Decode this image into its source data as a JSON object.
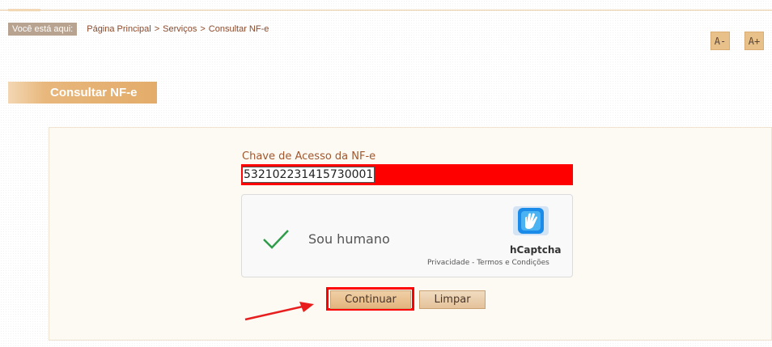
{
  "breadcrumb": {
    "label": "Você está aqui:",
    "items": [
      "Página Principal",
      "Serviços",
      "Consultar NF-e"
    ],
    "separator": ">"
  },
  "font_controls": {
    "decrease": "A-",
    "increase": "A+"
  },
  "section": {
    "title": "Consultar NF-e"
  },
  "form": {
    "field_label": "Chave de Acesso da NF-e",
    "field_value": "532102231415730001"
  },
  "captcha": {
    "label": "Sou humano",
    "brand": "hCaptcha",
    "links": "Privacidade - Termos e Condições"
  },
  "buttons": {
    "continue": "Continuar",
    "clear": "Limpar"
  },
  "colors": {
    "accent": "#e3ac6a",
    "highlight": "#ff0000",
    "link": "#8b4a2b"
  }
}
